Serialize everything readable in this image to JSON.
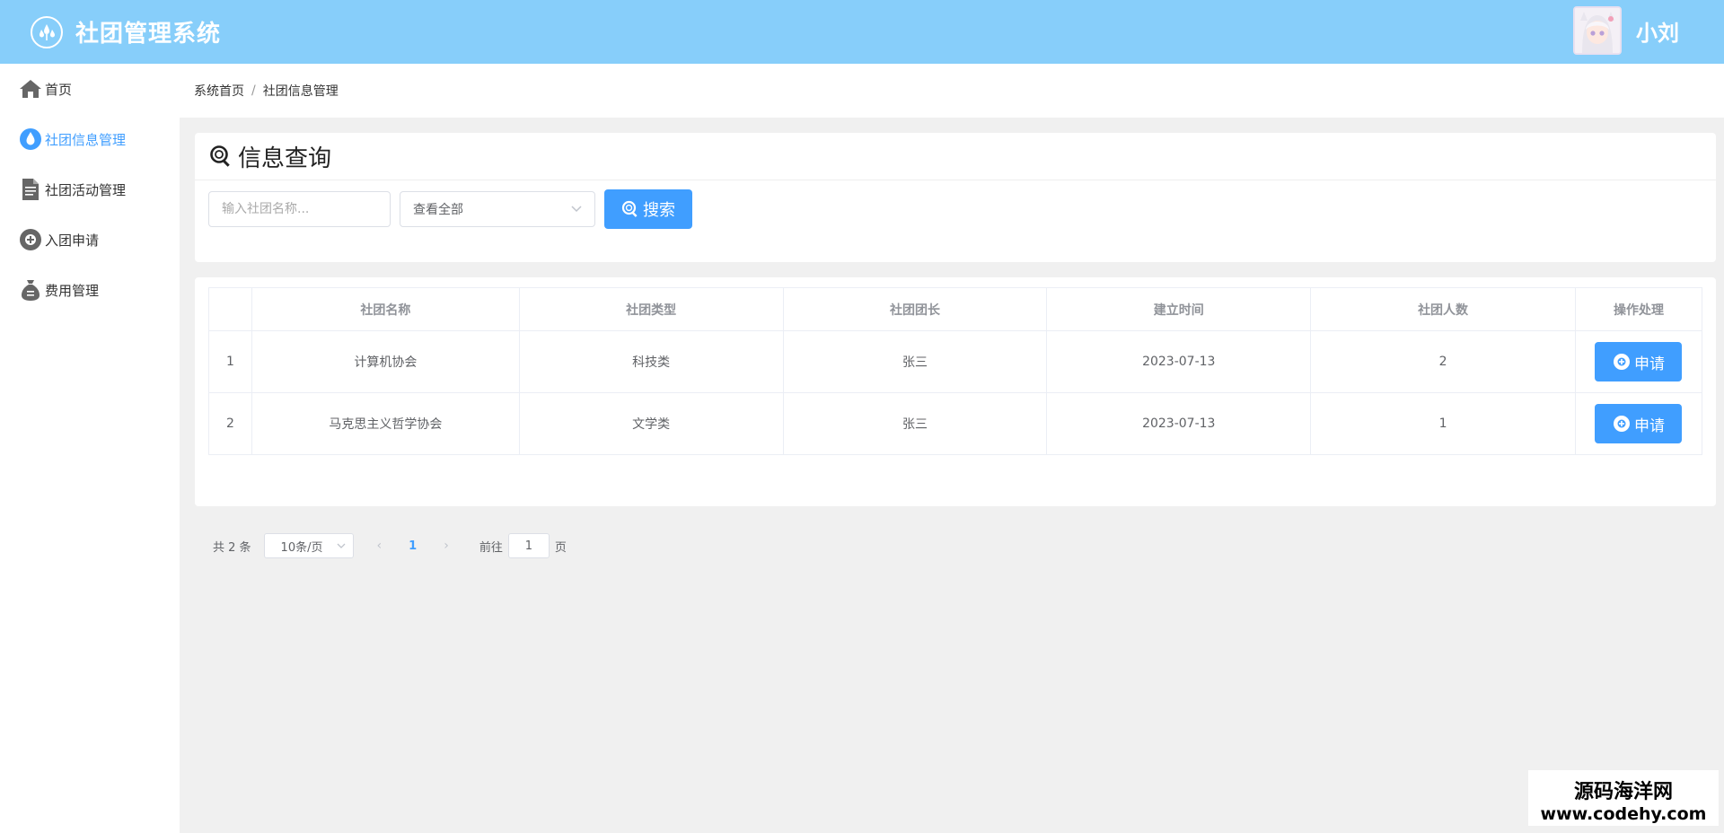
{
  "header": {
    "app_title": "社团管理系统",
    "user_name": "小刘",
    "bg_color": "#87cefa"
  },
  "sidebar": {
    "items": [
      {
        "label": "首页",
        "icon": "home-icon",
        "active": false
      },
      {
        "label": "社团信息管理",
        "icon": "water-drop-icon",
        "active": true
      },
      {
        "label": "社团活动管理",
        "icon": "document-icon",
        "active": false
      },
      {
        "label": "入团申请",
        "icon": "plus-circle-icon",
        "active": false
      },
      {
        "label": "费用管理",
        "icon": "money-bag-icon",
        "active": false
      }
    ]
  },
  "breadcrumb": {
    "home": "系统首页",
    "separator": "/",
    "current": "社团信息管理"
  },
  "query": {
    "title": "信息查询",
    "name_placeholder": "输入社团名称...",
    "name_value": "",
    "select_value": "查看全部",
    "search_label": "搜索"
  },
  "table": {
    "headers": [
      "",
      "社团名称",
      "社团类型",
      "社团团长",
      "建立时间",
      "社团人数",
      "操作处理"
    ],
    "rows": [
      {
        "index": "1",
        "name": "计算机协会",
        "type": "科技类",
        "leader": "张三",
        "date": "2023-07-13",
        "count": "2",
        "action": "申请"
      },
      {
        "index": "2",
        "name": "马克思主义哲学协会",
        "type": "文学类",
        "leader": "张三",
        "date": "2023-07-13",
        "count": "1",
        "action": "申请"
      }
    ]
  },
  "pager": {
    "total": "共 2 条",
    "page_size": "10条/页",
    "prev": "‹",
    "current_page": "1",
    "next": "›",
    "goto_label": "前往",
    "goto_value": "1",
    "page_unit": "页"
  },
  "watermark": {
    "line1": "源码海洋网",
    "line2": "www.codehy.com"
  },
  "colors": {
    "primary": "#409eff",
    "header": "#87cefa"
  }
}
